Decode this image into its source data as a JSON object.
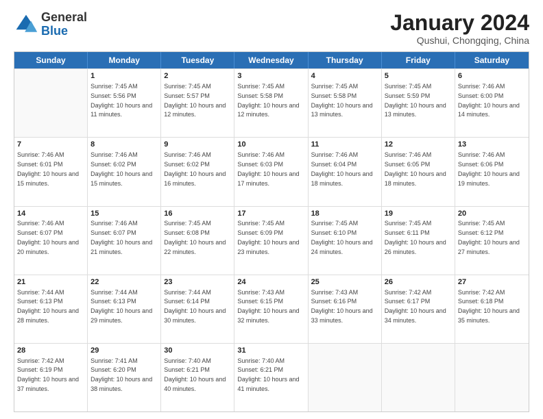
{
  "header": {
    "logo_general": "General",
    "logo_blue": "Blue",
    "month_title": "January 2024",
    "location": "Qushui, Chongqing, China"
  },
  "calendar": {
    "days_of_week": [
      "Sunday",
      "Monday",
      "Tuesday",
      "Wednesday",
      "Thursday",
      "Friday",
      "Saturday"
    ],
    "weeks": [
      [
        {
          "day": "",
          "sunrise": "",
          "sunset": "",
          "daylight": ""
        },
        {
          "day": "1",
          "sunrise": "Sunrise: 7:45 AM",
          "sunset": "Sunset: 5:56 PM",
          "daylight": "Daylight: 10 hours and 11 minutes."
        },
        {
          "day": "2",
          "sunrise": "Sunrise: 7:45 AM",
          "sunset": "Sunset: 5:57 PM",
          "daylight": "Daylight: 10 hours and 12 minutes."
        },
        {
          "day": "3",
          "sunrise": "Sunrise: 7:45 AM",
          "sunset": "Sunset: 5:58 PM",
          "daylight": "Daylight: 10 hours and 12 minutes."
        },
        {
          "day": "4",
          "sunrise": "Sunrise: 7:45 AM",
          "sunset": "Sunset: 5:58 PM",
          "daylight": "Daylight: 10 hours and 13 minutes."
        },
        {
          "day": "5",
          "sunrise": "Sunrise: 7:45 AM",
          "sunset": "Sunset: 5:59 PM",
          "daylight": "Daylight: 10 hours and 13 minutes."
        },
        {
          "day": "6",
          "sunrise": "Sunrise: 7:46 AM",
          "sunset": "Sunset: 6:00 PM",
          "daylight": "Daylight: 10 hours and 14 minutes."
        }
      ],
      [
        {
          "day": "7",
          "sunrise": "Sunrise: 7:46 AM",
          "sunset": "Sunset: 6:01 PM",
          "daylight": "Daylight: 10 hours and 15 minutes."
        },
        {
          "day": "8",
          "sunrise": "Sunrise: 7:46 AM",
          "sunset": "Sunset: 6:02 PM",
          "daylight": "Daylight: 10 hours and 15 minutes."
        },
        {
          "day": "9",
          "sunrise": "Sunrise: 7:46 AM",
          "sunset": "Sunset: 6:02 PM",
          "daylight": "Daylight: 10 hours and 16 minutes."
        },
        {
          "day": "10",
          "sunrise": "Sunrise: 7:46 AM",
          "sunset": "Sunset: 6:03 PM",
          "daylight": "Daylight: 10 hours and 17 minutes."
        },
        {
          "day": "11",
          "sunrise": "Sunrise: 7:46 AM",
          "sunset": "Sunset: 6:04 PM",
          "daylight": "Daylight: 10 hours and 18 minutes."
        },
        {
          "day": "12",
          "sunrise": "Sunrise: 7:46 AM",
          "sunset": "Sunset: 6:05 PM",
          "daylight": "Daylight: 10 hours and 18 minutes."
        },
        {
          "day": "13",
          "sunrise": "Sunrise: 7:46 AM",
          "sunset": "Sunset: 6:06 PM",
          "daylight": "Daylight: 10 hours and 19 minutes."
        }
      ],
      [
        {
          "day": "14",
          "sunrise": "Sunrise: 7:46 AM",
          "sunset": "Sunset: 6:07 PM",
          "daylight": "Daylight: 10 hours and 20 minutes."
        },
        {
          "day": "15",
          "sunrise": "Sunrise: 7:46 AM",
          "sunset": "Sunset: 6:07 PM",
          "daylight": "Daylight: 10 hours and 21 minutes."
        },
        {
          "day": "16",
          "sunrise": "Sunrise: 7:45 AM",
          "sunset": "Sunset: 6:08 PM",
          "daylight": "Daylight: 10 hours and 22 minutes."
        },
        {
          "day": "17",
          "sunrise": "Sunrise: 7:45 AM",
          "sunset": "Sunset: 6:09 PM",
          "daylight": "Daylight: 10 hours and 23 minutes."
        },
        {
          "day": "18",
          "sunrise": "Sunrise: 7:45 AM",
          "sunset": "Sunset: 6:10 PM",
          "daylight": "Daylight: 10 hours and 24 minutes."
        },
        {
          "day": "19",
          "sunrise": "Sunrise: 7:45 AM",
          "sunset": "Sunset: 6:11 PM",
          "daylight": "Daylight: 10 hours and 26 minutes."
        },
        {
          "day": "20",
          "sunrise": "Sunrise: 7:45 AM",
          "sunset": "Sunset: 6:12 PM",
          "daylight": "Daylight: 10 hours and 27 minutes."
        }
      ],
      [
        {
          "day": "21",
          "sunrise": "Sunrise: 7:44 AM",
          "sunset": "Sunset: 6:13 PM",
          "daylight": "Daylight: 10 hours and 28 minutes."
        },
        {
          "day": "22",
          "sunrise": "Sunrise: 7:44 AM",
          "sunset": "Sunset: 6:13 PM",
          "daylight": "Daylight: 10 hours and 29 minutes."
        },
        {
          "day": "23",
          "sunrise": "Sunrise: 7:44 AM",
          "sunset": "Sunset: 6:14 PM",
          "daylight": "Daylight: 10 hours and 30 minutes."
        },
        {
          "day": "24",
          "sunrise": "Sunrise: 7:43 AM",
          "sunset": "Sunset: 6:15 PM",
          "daylight": "Daylight: 10 hours and 32 minutes."
        },
        {
          "day": "25",
          "sunrise": "Sunrise: 7:43 AM",
          "sunset": "Sunset: 6:16 PM",
          "daylight": "Daylight: 10 hours and 33 minutes."
        },
        {
          "day": "26",
          "sunrise": "Sunrise: 7:42 AM",
          "sunset": "Sunset: 6:17 PM",
          "daylight": "Daylight: 10 hours and 34 minutes."
        },
        {
          "day": "27",
          "sunrise": "Sunrise: 7:42 AM",
          "sunset": "Sunset: 6:18 PM",
          "daylight": "Daylight: 10 hours and 35 minutes."
        }
      ],
      [
        {
          "day": "28",
          "sunrise": "Sunrise: 7:42 AM",
          "sunset": "Sunset: 6:19 PM",
          "daylight": "Daylight: 10 hours and 37 minutes."
        },
        {
          "day": "29",
          "sunrise": "Sunrise: 7:41 AM",
          "sunset": "Sunset: 6:20 PM",
          "daylight": "Daylight: 10 hours and 38 minutes."
        },
        {
          "day": "30",
          "sunrise": "Sunrise: 7:40 AM",
          "sunset": "Sunset: 6:21 PM",
          "daylight": "Daylight: 10 hours and 40 minutes."
        },
        {
          "day": "31",
          "sunrise": "Sunrise: 7:40 AM",
          "sunset": "Sunset: 6:21 PM",
          "daylight": "Daylight: 10 hours and 41 minutes."
        },
        {
          "day": "",
          "sunrise": "",
          "sunset": "",
          "daylight": ""
        },
        {
          "day": "",
          "sunrise": "",
          "sunset": "",
          "daylight": ""
        },
        {
          "day": "",
          "sunrise": "",
          "sunset": "",
          "daylight": ""
        }
      ]
    ]
  }
}
